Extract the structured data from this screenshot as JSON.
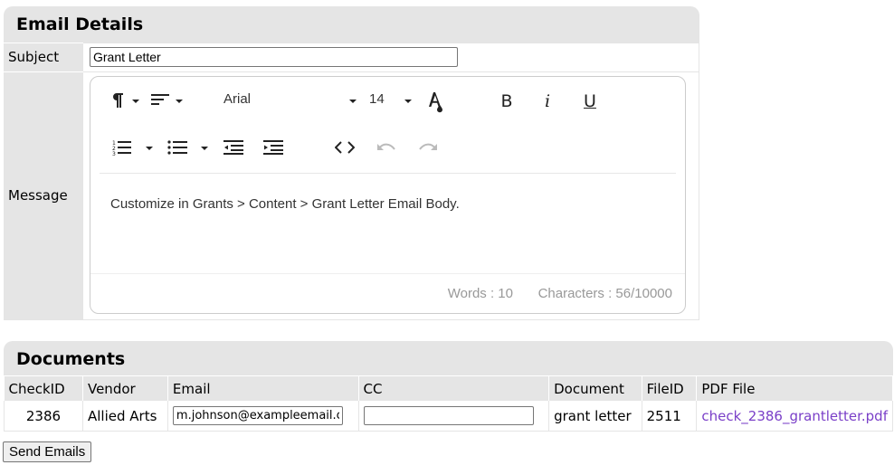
{
  "email_details": {
    "title": "Email Details",
    "subject_label": "Subject",
    "subject_value": "Grant Letter",
    "message_label": "Message",
    "editor": {
      "toolbar": {
        "icons": [
          "paragraph-format-icon",
          "paragraph-align-icon",
          "font-family-select",
          "font-size-select",
          "text-color-icon",
          "bold-icon",
          "italic-icon",
          "underline-icon",
          "ordered-list-icon",
          "unordered-list-icon",
          "outdent-icon",
          "indent-icon",
          "code-view-icon",
          "undo-icon",
          "redo-icon"
        ],
        "font_family": "Arial",
        "font_size": "14",
        "bold_glyph": "B",
        "italic_glyph": "i",
        "underline_glyph": "U"
      },
      "content": "Customize in Grants > Content > Grant Letter Email Body.",
      "word_count": "Words : 10",
      "char_count": "Characters : 56/10000"
    }
  },
  "documents": {
    "title": "Documents",
    "columns": [
      "CheckID",
      "Vendor",
      "Email",
      "CC",
      "Document",
      "FileID",
      "PDF File"
    ],
    "rows": [
      {
        "check_id": "2386",
        "vendor": "Allied Arts",
        "email": "m.johnson@exampleemail.com",
        "cc": "",
        "document": "grant letter",
        "file_id": "2511",
        "pdf_file": "check_2386_grantletter.pdf"
      }
    ]
  },
  "actions": {
    "send_label": "Send Emails"
  },
  "colors": {
    "panel_bg": "#e5e5e5",
    "link": "#7a3fc8",
    "muted_text": "#999999"
  }
}
